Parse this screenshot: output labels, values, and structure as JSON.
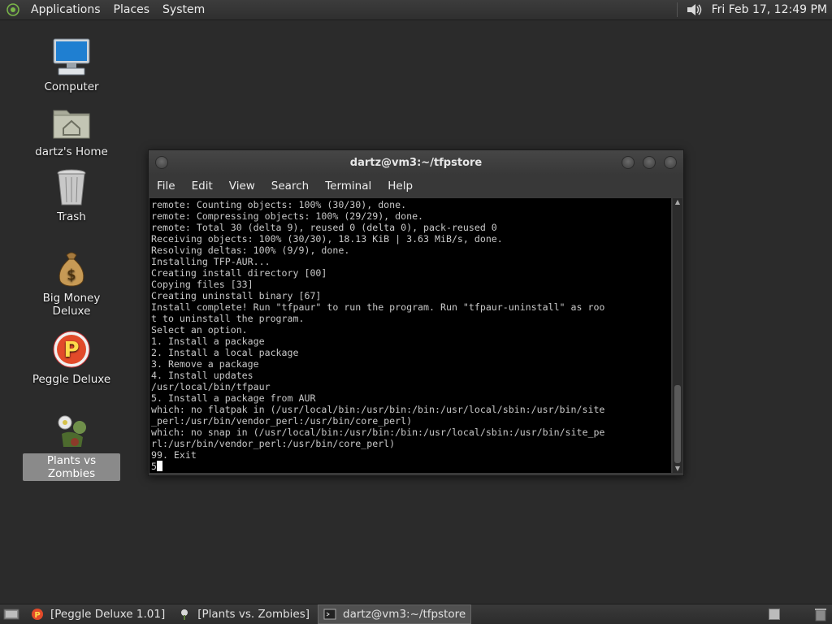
{
  "top_panel": {
    "menus": [
      "Applications",
      "Places",
      "System"
    ],
    "clock": "Fri Feb 17, 12:49 PM"
  },
  "desktop_icons": [
    {
      "label": "Computer",
      "icon": "computer-icon"
    },
    {
      "label": "dartz's Home",
      "icon": "home-folder-icon"
    },
    {
      "label": "Trash",
      "icon": "trash-icon"
    },
    {
      "label": "Big Money Deluxe",
      "icon": "money-bag-icon"
    },
    {
      "label": "Peggle Deluxe",
      "icon": "peggle-icon"
    },
    {
      "label": "Plants vs Zombies",
      "icon": "plants-icon"
    }
  ],
  "terminal": {
    "title": "dartz@vm3:~/tfpstore",
    "menu": [
      "File",
      "Edit",
      "View",
      "Search",
      "Terminal",
      "Help"
    ],
    "output": "remote: Counting objects: 100% (30/30), done.\nremote: Compressing objects: 100% (29/29), done.\nremote: Total 30 (delta 9), reused 0 (delta 0), pack-reused 0\nReceiving objects: 100% (30/30), 18.13 KiB | 3.63 MiB/s, done.\nResolving deltas: 100% (9/9), done.\nInstalling TFP-AUR...\nCreating install directory [00]\nCopying files [33]\nCreating uninstall binary [67]\nInstall complete! Run \"tfpaur\" to run the program. Run \"tfpaur-uninstall\" as roo\nt to uninstall the program.\nSelect an option.\n1. Install a package\n2. Install a local package\n3. Remove a package\n4. Install updates\n/usr/local/bin/tfpaur\n5. Install a package from AUR\nwhich: no flatpak in (/usr/local/bin:/usr/bin:/bin:/usr/local/sbin:/usr/bin/site\n_perl:/usr/bin/vendor_perl:/usr/bin/core_perl)\nwhich: no snap in (/usr/local/bin:/usr/bin:/bin:/usr/local/sbin:/usr/bin/site_pe\nrl:/usr/bin/vendor_perl:/usr/bin/core_perl)\n99. Exit\n",
    "input": "5"
  },
  "taskbar": [
    {
      "label": "[Peggle Deluxe 1.01]",
      "icon": "peggle-task-icon",
      "active": false
    },
    {
      "label": "[Plants vs. Zombies]",
      "icon": "plants-task-icon",
      "active": false
    },
    {
      "label": "dartz@vm3:~/tfpstore",
      "icon": "terminal-task-icon",
      "active": true
    }
  ]
}
